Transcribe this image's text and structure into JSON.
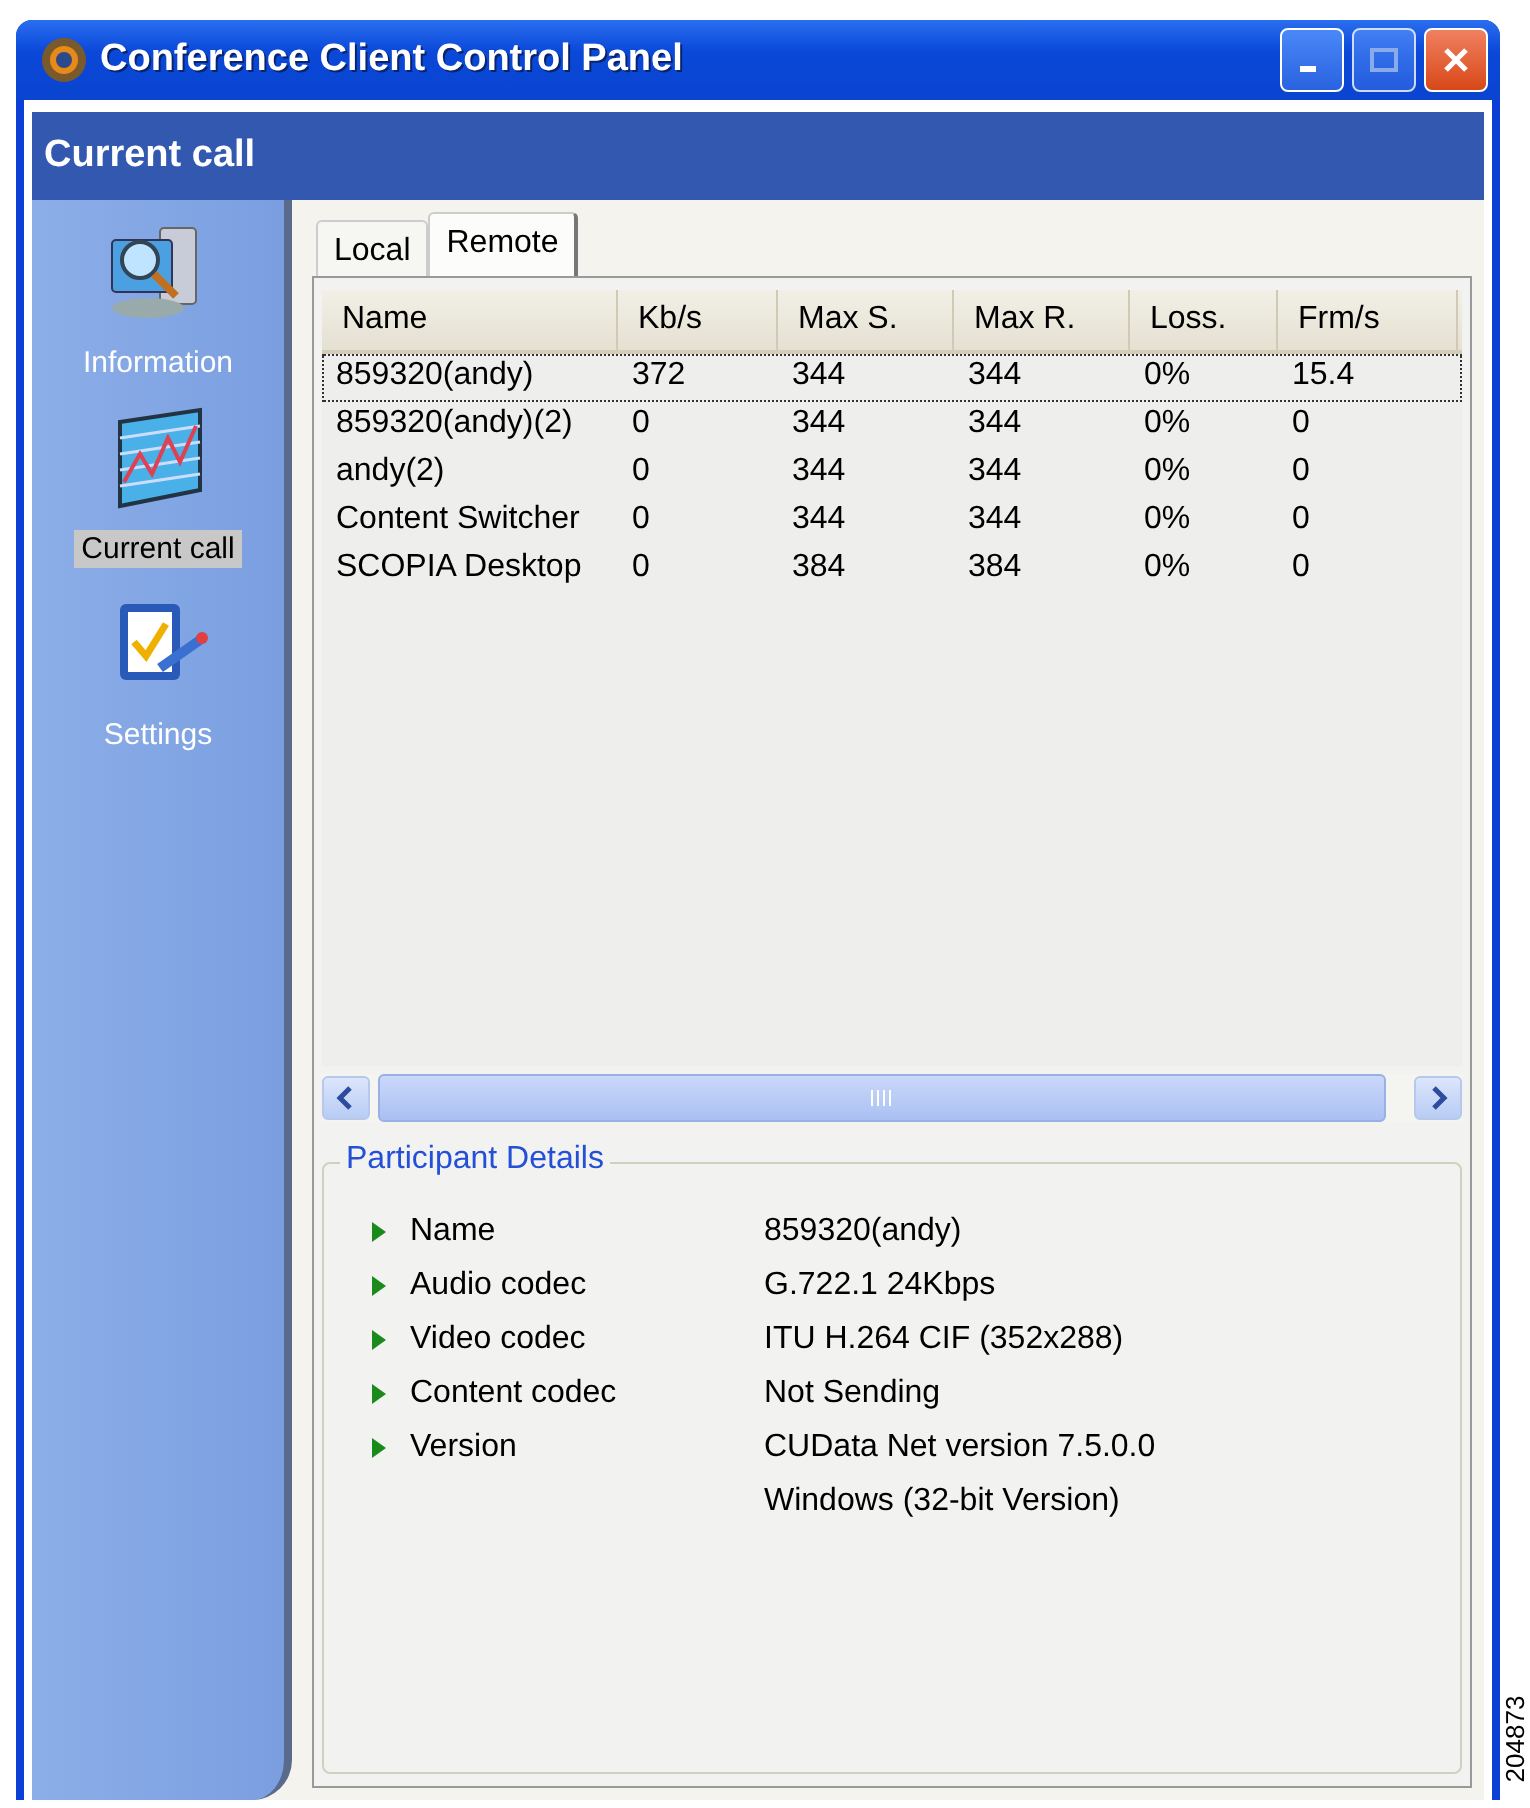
{
  "window": {
    "title": "Conference Client Control Panel"
  },
  "header": {
    "title": "Current call"
  },
  "sidebar": {
    "items": [
      {
        "label": "Information",
        "selected": false
      },
      {
        "label": "Current call",
        "selected": true
      },
      {
        "label": "Settings",
        "selected": false
      }
    ]
  },
  "tabs": [
    {
      "label": "Local",
      "selected": false
    },
    {
      "label": "Remote",
      "selected": true
    }
  ],
  "table": {
    "columns": [
      "Name",
      "Kb/s",
      "Max S.",
      "Max R.",
      "Loss.",
      "Frm/s"
    ],
    "rows": [
      {
        "cells": [
          "859320(andy)",
          "372",
          "344",
          "344",
          "0%",
          "15.4"
        ],
        "selected": true
      },
      {
        "cells": [
          "859320(andy)(2)",
          "0",
          "344",
          "344",
          "0%",
          "0"
        ],
        "selected": false
      },
      {
        "cells": [
          "andy(2)",
          "0",
          "344",
          "344",
          "0%",
          "0"
        ],
        "selected": false
      },
      {
        "cells": [
          "Content Switcher",
          "0",
          "344",
          "344",
          "0%",
          "0"
        ],
        "selected": false
      },
      {
        "cells": [
          "SCOPIA Desktop",
          "0",
          "384",
          "384",
          "0%",
          "0"
        ],
        "selected": false
      }
    ]
  },
  "details": {
    "title": "Participant Details",
    "items": [
      {
        "label": "Name",
        "value": "859320(andy)"
      },
      {
        "label": "Audio codec",
        "value": "G.722.1 24Kbps"
      },
      {
        "label": "Video codec",
        "value": "ITU H.264 CIF (352x288)"
      },
      {
        "label": "Content codec",
        "value": "Not Sending"
      },
      {
        "label": "Version",
        "value": "CUData Net version 7.5.0.0"
      },
      {
        "value": "Windows (32-bit Version)"
      }
    ]
  },
  "figure_id": "204873"
}
